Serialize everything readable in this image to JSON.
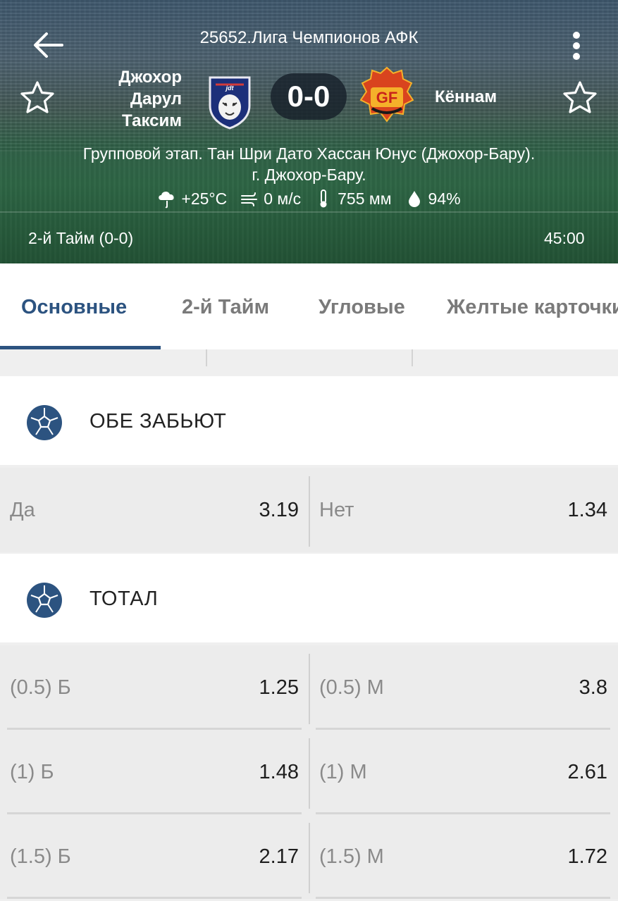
{
  "header": {
    "league": "25652.Лига Чемпионов АФК",
    "home_team": [
      "Джохор",
      "Дарул",
      "Таксим"
    ],
    "away_team": "Кённам",
    "score": "0-0",
    "venue_line1": "Групповой этап. Тан Шри Дато Хассан Юнус (Джохор-Бару).",
    "venue_line2": "г. Джохор-Бару.",
    "weather": {
      "temperature": "+25°C",
      "wind": "0 м/с",
      "pressure": "755 мм",
      "humidity": "94%"
    },
    "period": "2-й  Тайм (0-0)",
    "clock": "45:00"
  },
  "tabs": [
    {
      "label": "Основные",
      "active": true
    },
    {
      "label": "2-й  Тайм",
      "active": false
    },
    {
      "label": "Угловые",
      "active": false
    },
    {
      "label": "Желтые карточки",
      "active": false
    }
  ],
  "sections": [
    {
      "title": "ОБЕ ЗАБЬЮТ",
      "rows": [
        {
          "left_label": "Да",
          "left_value": "3.19",
          "right_label": "Нет",
          "right_value": "1.34"
        }
      ]
    },
    {
      "title": "ТОТАЛ",
      "rows": [
        {
          "left_label": "(0.5) Б",
          "left_value": "1.25",
          "right_label": "(0.5) М",
          "right_value": "3.8"
        },
        {
          "left_label": "(1) Б",
          "left_value": "1.48",
          "right_label": "(1) М",
          "right_value": "2.61"
        },
        {
          "left_label": "(1.5) Б",
          "left_value": "2.17",
          "right_label": "(1.5) М",
          "right_value": "1.72"
        }
      ]
    }
  ],
  "colors": {
    "accent": "#2c5380",
    "row_bg": "#ececec",
    "ball_icon": "#2c5380"
  },
  "icons": [
    "back-arrow-icon",
    "more-vertical-icon",
    "star-icon",
    "rain-cloud-icon",
    "wind-icon",
    "thermometer-icon",
    "drop-icon",
    "soccer-ball-icon"
  ]
}
